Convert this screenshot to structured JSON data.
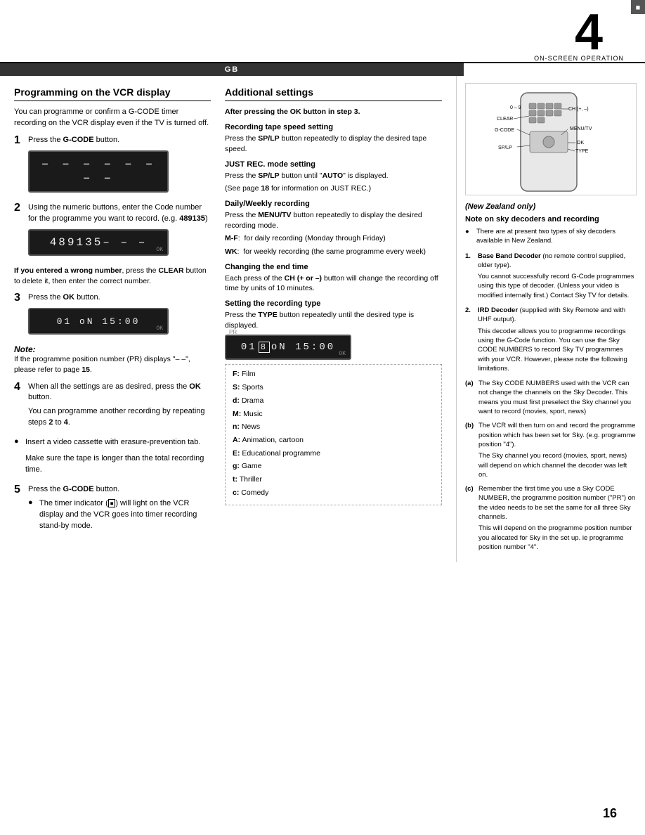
{
  "header": {
    "chapter_number": "4",
    "chapter_label": "ON-SCREEN OPERATION",
    "gb_label": "GB"
  },
  "left_section": {
    "title": "Programming on the VCR display",
    "intro": "You can programme or confirm a G-CODE timer recording on the VCR display even if the TV is turned off.",
    "steps": [
      {
        "num": "1",
        "text": "Press the G-CODE button.",
        "display": "- - - - - - - -"
      },
      {
        "num": "2",
        "text_parts": [
          "Using the numeric buttons, enter the Code number for the programme you want to record. (e.g. ",
          "489135",
          ")"
        ],
        "display": "489135- - -"
      },
      {
        "wrong_num_text": "If you entered a wrong number, press the CLEAR button to delete it, then enter the correct number."
      },
      {
        "num": "3",
        "text": "Press the OK button.",
        "display": "01 oN 15:00"
      }
    ],
    "note_title": "Note:",
    "note_text": "If the programme position number (PR) displays \"– –\", please refer to page 15.",
    "step4": {
      "num": "4",
      "text": "When all the settings are as desired, press the OK button.",
      "text2": "You can programme another recording by repeating steps 2 to 4."
    },
    "bullet1": "Insert a video cassette with erasure-prevention tab.",
    "bullet2": "Make sure the tape is longer than the total recording time.",
    "step5": {
      "num": "5",
      "text_parts": [
        "Press the ",
        "G-CODE",
        " button."
      ],
      "bullet": "The timer indicator (    ) will light on the VCR display and the VCR goes into timer recording stand-by mode."
    }
  },
  "right_section_left": {
    "title": "Additional settings",
    "after_ok": "After pressing the OK button in step 3.",
    "subsections": [
      {
        "title": "Recording tape speed setting",
        "text": "Press the SP/LP button repeatedly to display the desired tape speed."
      },
      {
        "title": "JUST REC. mode setting",
        "text_parts": [
          "Press the ",
          "SP/LP",
          " button until \"AUTO\" is displayed."
        ],
        "note": "(See page 18 for information on JUST REC.)"
      },
      {
        "title": "Daily/Weekly recording",
        "text_parts": [
          "Press the ",
          "MENU/TV",
          " button repeatedly to display the desired recording mode."
        ],
        "mf": "M-F:  for daily recording (Monday through Friday)",
        "wk": "WK:  for weekly recording (the same programme every week)"
      },
      {
        "title": "Changing the end time",
        "text": "Each press of the CH (+ or –) button will change the recording off time by units of 10 minutes."
      },
      {
        "title": "Setting the recording type",
        "text_parts": [
          "Press the ",
          "TYPE",
          " button repeatedly until the desired type is displayed."
        ],
        "display": "01 oN 15:00"
      }
    ],
    "type_list": [
      "F:  Film",
      "S:  Sports",
      "d:  Drama",
      "M:  Music",
      "n:  News",
      "A:  Animation, cartoon",
      "E:  Educational programme",
      "g:  Game",
      "t:  Thriller",
      "c:  Comedy"
    ]
  },
  "right_panel": {
    "nz_label": "(New Zealand only)",
    "sky_title": "Note on sky decoders and recording",
    "bullet_intro": "There are at present two types of sky decoders available in New Zealand.",
    "decoders": [
      {
        "num": "1.",
        "name": "Base Band Decoder",
        "name_suffix": " (no remote control supplied, older type).",
        "text": "You cannot successfully record G-Code programmes using this type of decoder. (Unless your video is modified internally first.) Contact Sky TV for details."
      },
      {
        "num": "2.",
        "name": "IRD Decoder",
        "name_suffix": " (supplied with Sky Remote and with UHF output).",
        "text": "This decoder allows you to programme recordings using the G-Code function. You can use the Sky CODE NUMBERS to record Sky TV programmes with your VCR. However, please note the following limitations."
      }
    ],
    "limitations": [
      {
        "label": "(a)",
        "text": "The Sky CODE NUMBERS used with the VCR can not change the channels on the Sky Decoder. This means you must first preselect the Sky channel you want to record (movies, sport, news)"
      },
      {
        "label": "(b)",
        "text_parts": [
          "The VCR will then turn on and record the programme position which has been set for Sky. (e.g. programme position \"4\").",
          "The Sky channel you record (movies, sport, news) will depend on which channel the decoder was left on."
        ]
      },
      {
        "label": "(c)",
        "text_parts": [
          "Remember the first time you use a Sky CODE NUMBER, the programme position number (\"PR\") on the video needs to be set the same for all three Sky channels.",
          "This will depend on the programme position number you allocated for Sky in the set up. ie programme position number \"4\"."
        ]
      }
    ]
  },
  "page_number": "16"
}
